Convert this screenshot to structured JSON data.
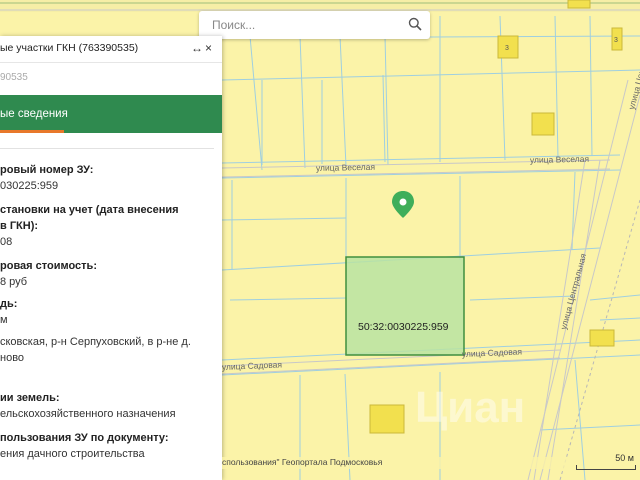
{
  "panel": {
    "title": "ые участки ГКН (763390535)",
    "id_fragment": "90535",
    "expand_glyph": "↔",
    "close_glyph": "×",
    "tab_label": "ые сведения"
  },
  "fields": [
    {
      "label": "ровый номер ЗУ:",
      "value": "030225:959"
    },
    {
      "label": "становки на учет (дата внесения",
      "label2": "в ГКН):",
      "value": "08"
    },
    {
      "label": "ровая стоимость:",
      "value": "8 руб"
    },
    {
      "label": "дь:",
      "value": "м"
    },
    {
      "label": "",
      "value": "сковская, р-н Серпуховский, в р-не д.",
      "value2": "ново"
    },
    {
      "label": "ии земель:",
      "value": "ельскохозяйственного назначения"
    },
    {
      "label": "пользования ЗУ по документу:",
      "value": "ения дачного строительства"
    }
  ],
  "search": {
    "placeholder": "Поиск..."
  },
  "map": {
    "streets": [
      "улица Веселая",
      "улица Веселая",
      "улица Садовая",
      "улица Садовая",
      "улица Центральная",
      "улица Центральная"
    ],
    "parcel_label": "50:32:0030225:959",
    "attribution": "спользования\" Геопортала Подмосковья",
    "scale": "50 м",
    "house_numbers": [
      "3",
      "3"
    ],
    "watermark": "Циан"
  },
  "colors": {
    "accent": "#2f8a4f",
    "tab_underline": "#e8782a",
    "map_bg": "#fbf3a8",
    "parcel_fill": "#b9e3a2",
    "parcel_border": "#3f8f3f",
    "marker": "#3fae5a",
    "building": "#f2e04e"
  }
}
